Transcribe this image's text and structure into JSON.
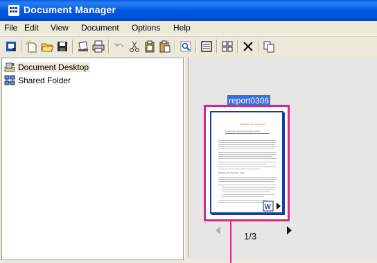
{
  "window": {
    "title": "Document Manager"
  },
  "menu": [
    "File",
    "Edit",
    "View",
    "Document",
    "Options",
    "Help"
  ],
  "toolbar": {
    "buttons": [
      "properties-icon",
      "new-document-icon",
      "open-folder-icon",
      "save-icon",
      "scan-icon",
      "print-icon",
      "undo-icon",
      "cut-icon",
      "copy-icon",
      "paste-icon",
      "find-icon",
      "view-single-icon",
      "view-thumbnails-icon",
      "delete-icon",
      "duplicate-icon"
    ]
  },
  "tree": {
    "items": [
      {
        "label": "Document Desktop",
        "icon": "desktop-icon",
        "selected": true
      },
      {
        "label": "Shared Folder",
        "icon": "shared-folder-icon",
        "selected": false
      }
    ]
  },
  "document": {
    "name": "report0306",
    "page_indicator": "1/3",
    "preview": {
      "heading": "Planning Your Deployment",
      "subheading": "Deployment and Administration Notes",
      "section": "Working with Windows Vista"
    }
  },
  "colors": {
    "title_bar": "#0058e6",
    "selection_border": "#d6287f",
    "label_highlight": "#3a6ed8"
  }
}
